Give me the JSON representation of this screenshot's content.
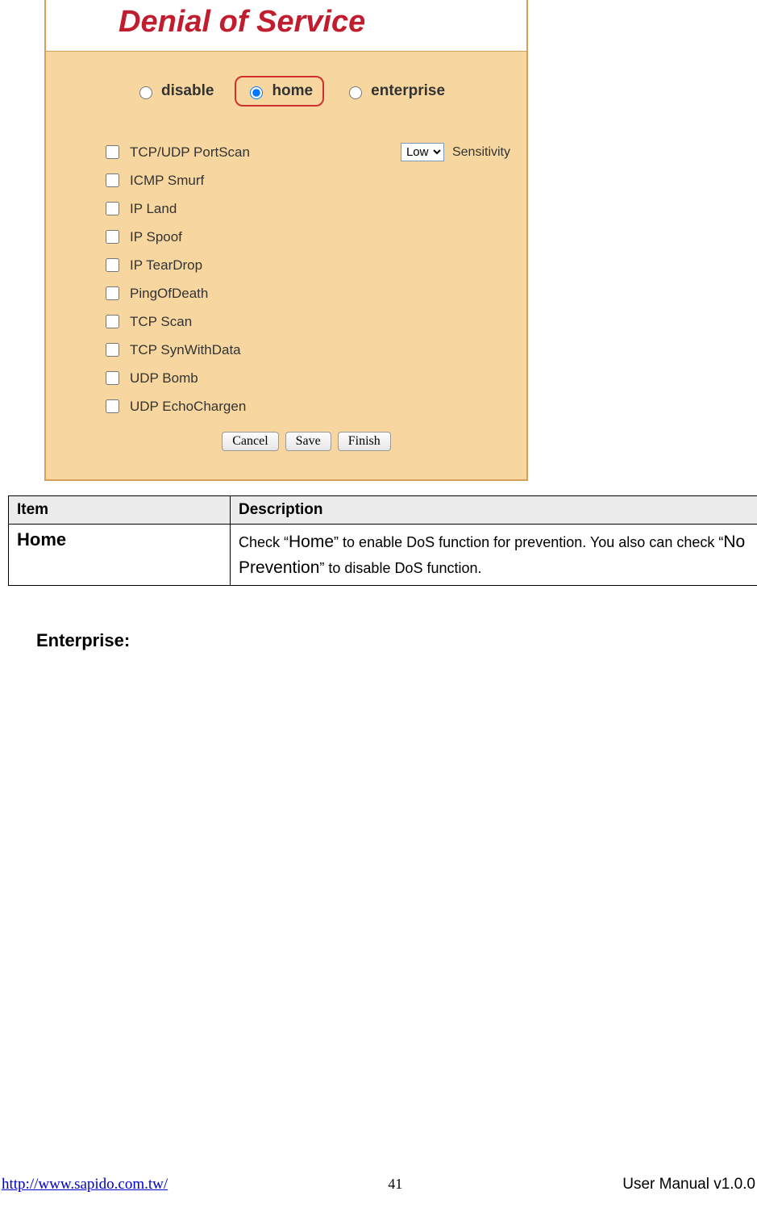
{
  "panel": {
    "title": "Denial of Service",
    "radios": {
      "disable": "disable",
      "home": "home",
      "enterprise": "enterprise",
      "selected": "home"
    },
    "sensitivity": {
      "value": "Low",
      "label": "Sensitivity"
    },
    "checks": [
      "TCP/UDP PortScan",
      "ICMP Smurf",
      "IP Land",
      "IP Spoof",
      "IP TearDrop",
      "PingOfDeath",
      "TCP Scan",
      "TCP SynWithData",
      "UDP Bomb",
      "UDP EchoChargen"
    ],
    "buttons": {
      "cancel": "Cancel",
      "save": "Save",
      "finish": "Finish"
    }
  },
  "table": {
    "head": {
      "item": "Item",
      "desc": "Description"
    },
    "rows": [
      {
        "item": "Home",
        "desc_parts": {
          "p1": "Check “",
          "big1": "Home",
          "p2": "” to enable DoS function for prevention. You also can check “",
          "big2": "No Prevention",
          "p3": "” to disable DoS function."
        }
      }
    ]
  },
  "section": {
    "enterprise": "Enterprise:"
  },
  "footer": {
    "url": "http://www.sapido.com.tw/",
    "page": "41",
    "version": "User Manual v1.0.0"
  }
}
